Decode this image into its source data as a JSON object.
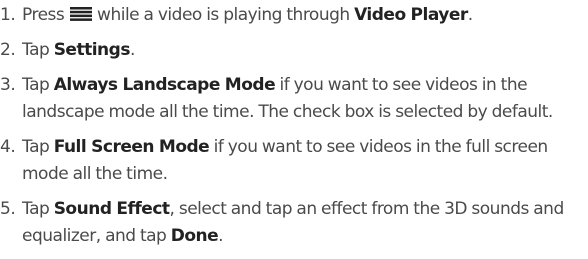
{
  "steps": [
    {
      "num": "1.",
      "parts": [
        "Press ",
        "menu-icon",
        " while a video is playing through ",
        "Video Player",
        "."
      ]
    },
    {
      "num": "2.",
      "parts": [
        "Tap ",
        "Settings",
        "."
      ]
    },
    {
      "num": "3.",
      "parts": [
        "Tap ",
        "Always Landscape Mode",
        " if you want to see videos in the landscape mode all the time. The check box is selected by default."
      ]
    },
    {
      "num": "4.",
      "parts": [
        "Tap ",
        "Full Screen Mode",
        " if you want to see videos in the full screen mode all the time."
      ]
    },
    {
      "num": "5.",
      "parts": [
        "Tap ",
        "Sound Effect",
        ", select and tap an effect from the 3D sounds and equalizer, and tap ",
        "Done",
        "."
      ]
    }
  ]
}
